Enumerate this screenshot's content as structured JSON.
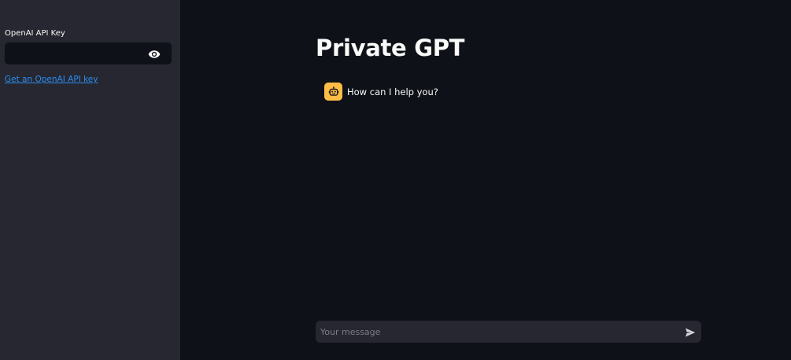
{
  "sidebar": {
    "api_key_label": "OpenAI API Key",
    "api_key_value": "",
    "api_key_link": "Get an OpenAI API key",
    "icons": {
      "visibility_toggle": "eye-icon"
    }
  },
  "main": {
    "title": "Private GPT",
    "messages": [
      {
        "role": "assistant",
        "avatar_icon": "robot-face-icon",
        "text": "How can I help you?"
      }
    ],
    "chat_input": {
      "placeholder": "Your message",
      "send_icon": "send-icon"
    }
  },
  "colors": {
    "main_background": "#0e1117",
    "sidebar_background": "#262730",
    "text": "#fafafa",
    "link": "#2b8ff0",
    "avatar_background": "#ffbd45"
  }
}
